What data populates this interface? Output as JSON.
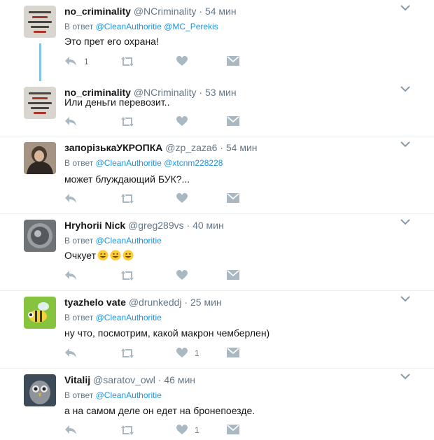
{
  "colors": {
    "link": "#1b95e0",
    "meta": "#657786",
    "thread_line": "#7ec5e8",
    "icon": "#aab8c2"
  },
  "tweets": [
    {
      "name": "no_criminality",
      "handle": "@NCriminality",
      "sep": "·",
      "time": "54 мин",
      "reply_prefix": "В ответ",
      "reply_to": [
        "@CleanAuthoritie",
        "@MC_Perekis"
      ],
      "text": "Это прет его охрана!",
      "reply_count": "1",
      "retweet_count": "",
      "like_count": "",
      "avatar_icon": "sign-avatar-icon"
    },
    {
      "name": "no_criminality",
      "handle": "@NCriminality",
      "sep": "·",
      "time": "53 мин",
      "reply_prefix": "",
      "reply_to": [],
      "text": "Или деньги перевозит..",
      "reply_count": "",
      "retweet_count": "",
      "like_count": "",
      "avatar_icon": "sign-avatar-icon"
    },
    {
      "name": "запорізькаУКРОПКА",
      "handle": "@zp_zaza6",
      "sep": "·",
      "time": "54 мин",
      "reply_prefix": "В ответ",
      "reply_to": [
        "@CleanAuthoritie",
        "@xtcnm228228"
      ],
      "text": "может блуждающий БУК?...",
      "reply_count": "",
      "retweet_count": "",
      "like_count": "",
      "avatar_icon": "woman-photo-avatar-icon"
    },
    {
      "name": "Hryhorii Nick",
      "handle": "@greg289vs",
      "sep": "·",
      "time": "40 мин",
      "reply_prefix": "В ответ",
      "reply_to": [
        "@CleanAuthoritie"
      ],
      "text": "Очкует",
      "emojis": [
        "grinning-emoji-icon",
        "grinning-emoji-icon",
        "grinning-emoji-icon"
      ],
      "reply_count": "",
      "retweet_count": "",
      "like_count": "",
      "avatar_icon": "coin-photo-avatar-icon"
    },
    {
      "name": "tyazhelo vate",
      "handle": "@drunkeddj",
      "sep": "·",
      "time": "25 мин",
      "reply_prefix": "В ответ",
      "reply_to": [
        "@CleanAuthoritie"
      ],
      "text": "ну что, посмотрим, какой макрон чемберлен)",
      "reply_count": "",
      "retweet_count": "",
      "like_count": "1",
      "avatar_icon": "bee-avatar-icon"
    },
    {
      "name": "Vitalij",
      "handle": "@saratov_owl",
      "sep": "·",
      "time": "46 мин",
      "reply_prefix": "В ответ",
      "reply_to": [
        "@CleanAuthoritie"
      ],
      "text": "а на самом деле он едет на бронепоезде.",
      "reply_count": "",
      "retweet_count": "",
      "like_count": "1",
      "avatar_icon": "owl-avatar-icon"
    }
  ]
}
